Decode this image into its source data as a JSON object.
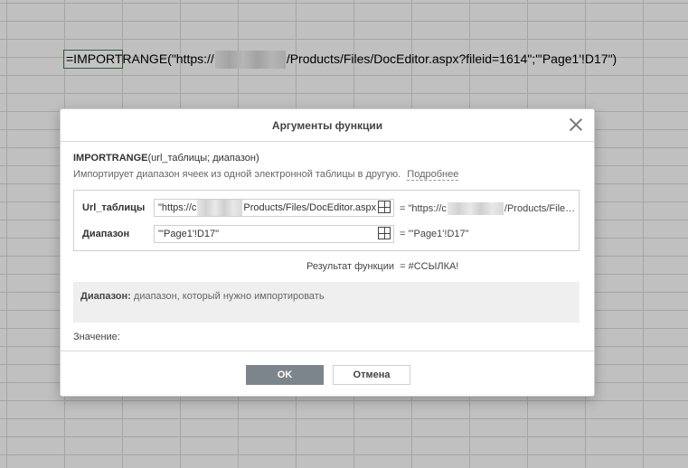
{
  "formula_bar": {
    "prefix": "=IMPORTRANGE(\"https://",
    "suffix": "/Products/Files/DocEditor.aspx?fileid=1614\";\"'Page1'!D17\")"
  },
  "dialog": {
    "title": "Аргументы функции",
    "function_signature_name": "IMPORTRANGE",
    "function_signature_args": "(url_таблицы; диапазон)",
    "description": "Импортирует диапазон ячеек из одной электронной таблицы в другую.",
    "more_link": "Подробнее",
    "args": [
      {
        "label": "Url_таблицы",
        "input_prefix": "\"https://c",
        "input_suffix": "Products/Files/DocEditor.aspx",
        "value_prefix": "= \"https://c",
        "value_suffix": "/Products/Files/..."
      },
      {
        "label": "Диапазон",
        "input_value": "\"'Page1'!D17\"",
        "value": "= \"'Page1'!D17\""
      }
    ],
    "result_label": "Результат функции",
    "result_value": "= #ССЫЛКА!",
    "hint_name": "Диапазон:",
    "hint_text": "диапазон, который нужно импортировать",
    "value_label": "Значение:",
    "ok_label": "OK",
    "cancel_label": "Отмена"
  },
  "icons": {
    "close": "close-icon",
    "range_select": "range-select-icon"
  }
}
